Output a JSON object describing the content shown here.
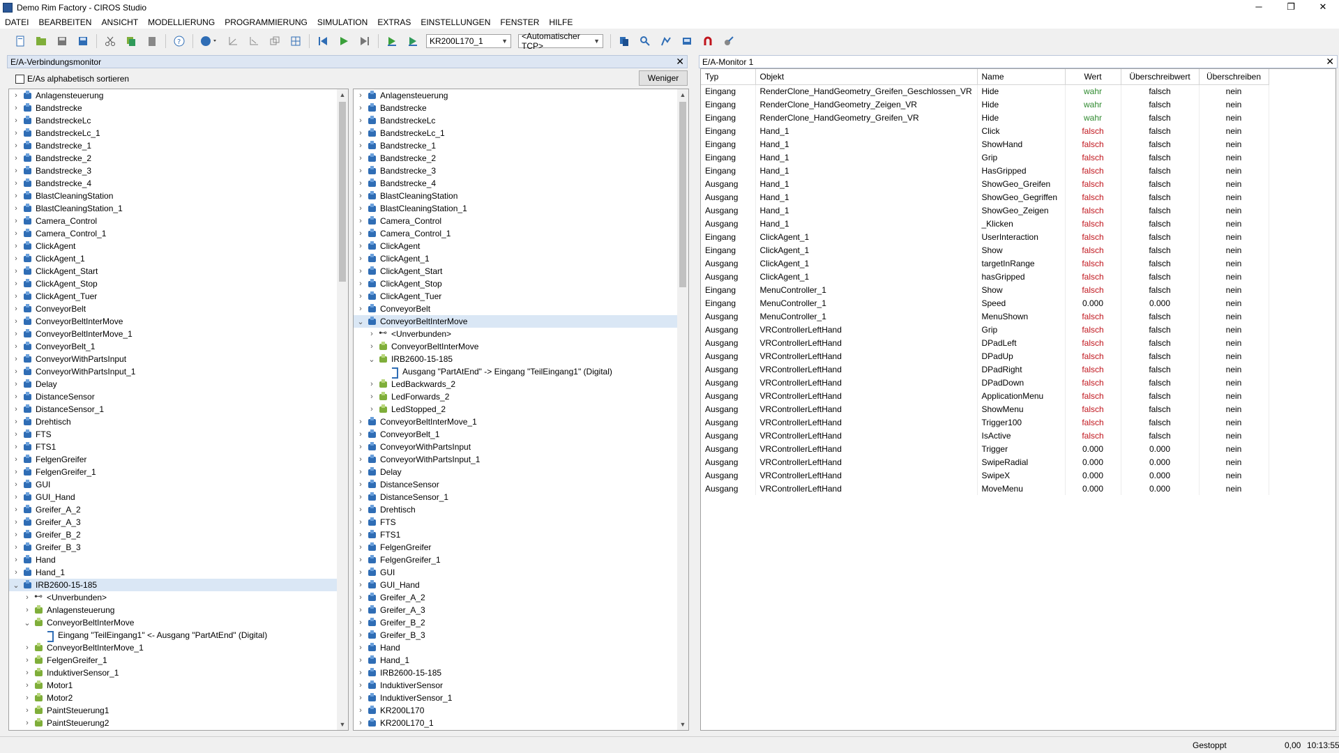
{
  "window": {
    "title": "Demo Rim Factory - CIROS Studio",
    "min": "─",
    "max": "❐",
    "close": "✕"
  },
  "menu": [
    "DATEI",
    "BEARBEITEN",
    "ANSICHT",
    "MODELLIERUNG",
    "PROGRAMMIERUNG",
    "SIMULATION",
    "EXTRAS",
    "EINSTELLUNGEN",
    "FENSTER",
    "HILFE"
  ],
  "toolbar": {
    "robot_select": "KR200L170_1",
    "tcp_select": "<Automatischer TCP>"
  },
  "left_panel": {
    "title": "E/A-Verbindungsmonitor",
    "sort_label": "E/As alphabetisch sortieren",
    "less_button": "Weniger",
    "tree1": [
      {
        "label": "Anlagensteuerung",
        "level": 0,
        "exp": ">",
        "icon": "node"
      },
      {
        "label": "Bandstrecke",
        "level": 0,
        "exp": ">",
        "icon": "node"
      },
      {
        "label": "BandstreckeLc",
        "level": 0,
        "exp": ">",
        "icon": "node"
      },
      {
        "label": "BandstreckeLc_1",
        "level": 0,
        "exp": ">",
        "icon": "node"
      },
      {
        "label": "Bandstrecke_1",
        "level": 0,
        "exp": ">",
        "icon": "node"
      },
      {
        "label": "Bandstrecke_2",
        "level": 0,
        "exp": ">",
        "icon": "node"
      },
      {
        "label": "Bandstrecke_3",
        "level": 0,
        "exp": ">",
        "icon": "node"
      },
      {
        "label": "Bandstrecke_4",
        "level": 0,
        "exp": ">",
        "icon": "node"
      },
      {
        "label": "BlastCleaningStation",
        "level": 0,
        "exp": ">",
        "icon": "node"
      },
      {
        "label": "BlastCleaningStation_1",
        "level": 0,
        "exp": ">",
        "icon": "node"
      },
      {
        "label": "Camera_Control",
        "level": 0,
        "exp": ">",
        "icon": "node"
      },
      {
        "label": "Camera_Control_1",
        "level": 0,
        "exp": ">",
        "icon": "node"
      },
      {
        "label": "ClickAgent",
        "level": 0,
        "exp": ">",
        "icon": "node"
      },
      {
        "label": "ClickAgent_1",
        "level": 0,
        "exp": ">",
        "icon": "node"
      },
      {
        "label": "ClickAgent_Start",
        "level": 0,
        "exp": ">",
        "icon": "node"
      },
      {
        "label": "ClickAgent_Stop",
        "level": 0,
        "exp": ">",
        "icon": "node"
      },
      {
        "label": "ClickAgent_Tuer",
        "level": 0,
        "exp": ">",
        "icon": "node"
      },
      {
        "label": "ConveyorBelt",
        "level": 0,
        "exp": ">",
        "icon": "node"
      },
      {
        "label": "ConveyorBeltInterMove",
        "level": 0,
        "exp": ">",
        "icon": "node"
      },
      {
        "label": "ConveyorBeltInterMove_1",
        "level": 0,
        "exp": ">",
        "icon": "node"
      },
      {
        "label": "ConveyorBelt_1",
        "level": 0,
        "exp": ">",
        "icon": "node"
      },
      {
        "label": "ConveyorWithPartsInput",
        "level": 0,
        "exp": ">",
        "icon": "node"
      },
      {
        "label": "ConveyorWithPartsInput_1",
        "level": 0,
        "exp": ">",
        "icon": "node"
      },
      {
        "label": "Delay",
        "level": 0,
        "exp": ">",
        "icon": "node"
      },
      {
        "label": "DistanceSensor",
        "level": 0,
        "exp": ">",
        "icon": "node"
      },
      {
        "label": "DistanceSensor_1",
        "level": 0,
        "exp": ">",
        "icon": "node"
      },
      {
        "label": "Drehtisch",
        "level": 0,
        "exp": ">",
        "icon": "node"
      },
      {
        "label": "FTS",
        "level": 0,
        "exp": ">",
        "icon": "node"
      },
      {
        "label": "FTS1",
        "level": 0,
        "exp": ">",
        "icon": "node"
      },
      {
        "label": "FelgenGreifer",
        "level": 0,
        "exp": ">",
        "icon": "node"
      },
      {
        "label": "FelgenGreifer_1",
        "level": 0,
        "exp": ">",
        "icon": "node"
      },
      {
        "label": "GUI",
        "level": 0,
        "exp": ">",
        "icon": "node"
      },
      {
        "label": "GUI_Hand",
        "level": 0,
        "exp": ">",
        "icon": "node"
      },
      {
        "label": "Greifer_A_2",
        "level": 0,
        "exp": ">",
        "icon": "node"
      },
      {
        "label": "Greifer_A_3",
        "level": 0,
        "exp": ">",
        "icon": "node"
      },
      {
        "label": "Greifer_B_2",
        "level": 0,
        "exp": ">",
        "icon": "node"
      },
      {
        "label": "Greifer_B_3",
        "level": 0,
        "exp": ">",
        "icon": "node"
      },
      {
        "label": "Hand",
        "level": 0,
        "exp": ">",
        "icon": "node"
      },
      {
        "label": "Hand_1",
        "level": 0,
        "exp": ">",
        "icon": "node"
      },
      {
        "label": "IRB2600-15-185",
        "level": 0,
        "exp": "v",
        "icon": "node",
        "selected": true
      },
      {
        "label": "<Unverbunden>",
        "level": 1,
        "exp": ">",
        "icon": "unb"
      },
      {
        "label": "Anlagensteuerung",
        "level": 1,
        "exp": ">",
        "icon": "conn"
      },
      {
        "label": "ConveyorBeltInterMove",
        "level": 1,
        "exp": "v",
        "icon": "conn"
      },
      {
        "label": "Eingang \"TeilEingang1\" <- Ausgang \"PartAtEnd\" (Digital)",
        "level": 2,
        "exp": "",
        "icon": "sig"
      },
      {
        "label": "ConveyorBeltInterMove_1",
        "level": 1,
        "exp": ">",
        "icon": "conn"
      },
      {
        "label": "FelgenGreifer_1",
        "level": 1,
        "exp": ">",
        "icon": "conn"
      },
      {
        "label": "InduktiverSensor_1",
        "level": 1,
        "exp": ">",
        "icon": "conn"
      },
      {
        "label": "Motor1",
        "level": 1,
        "exp": ">",
        "icon": "conn"
      },
      {
        "label": "Motor2",
        "level": 1,
        "exp": ">",
        "icon": "conn"
      },
      {
        "label": "PaintSteuerung1",
        "level": 1,
        "exp": ">",
        "icon": "conn"
      },
      {
        "label": "PaintSteuerung2",
        "level": 1,
        "exp": ">",
        "icon": "conn"
      }
    ],
    "tree2": [
      {
        "label": "Anlagensteuerung",
        "level": 0,
        "exp": ">",
        "icon": "node"
      },
      {
        "label": "Bandstrecke",
        "level": 0,
        "exp": ">",
        "icon": "node"
      },
      {
        "label": "BandstreckeLc",
        "level": 0,
        "exp": ">",
        "icon": "node"
      },
      {
        "label": "BandstreckeLc_1",
        "level": 0,
        "exp": ">",
        "icon": "node"
      },
      {
        "label": "Bandstrecke_1",
        "level": 0,
        "exp": ">",
        "icon": "node"
      },
      {
        "label": "Bandstrecke_2",
        "level": 0,
        "exp": ">",
        "icon": "node"
      },
      {
        "label": "Bandstrecke_3",
        "level": 0,
        "exp": ">",
        "icon": "node"
      },
      {
        "label": "Bandstrecke_4",
        "level": 0,
        "exp": ">",
        "icon": "node"
      },
      {
        "label": "BlastCleaningStation",
        "level": 0,
        "exp": ">",
        "icon": "node"
      },
      {
        "label": "BlastCleaningStation_1",
        "level": 0,
        "exp": ">",
        "icon": "node"
      },
      {
        "label": "Camera_Control",
        "level": 0,
        "exp": ">",
        "icon": "node"
      },
      {
        "label": "Camera_Control_1",
        "level": 0,
        "exp": ">",
        "icon": "node"
      },
      {
        "label": "ClickAgent",
        "level": 0,
        "exp": ">",
        "icon": "node"
      },
      {
        "label": "ClickAgent_1",
        "level": 0,
        "exp": ">",
        "icon": "node"
      },
      {
        "label": "ClickAgent_Start",
        "level": 0,
        "exp": ">",
        "icon": "node"
      },
      {
        "label": "ClickAgent_Stop",
        "level": 0,
        "exp": ">",
        "icon": "node"
      },
      {
        "label": "ClickAgent_Tuer",
        "level": 0,
        "exp": ">",
        "icon": "node"
      },
      {
        "label": "ConveyorBelt",
        "level": 0,
        "exp": ">",
        "icon": "node"
      },
      {
        "label": "ConveyorBeltInterMove",
        "level": 0,
        "exp": "v",
        "icon": "node",
        "selected": true
      },
      {
        "label": "<Unverbunden>",
        "level": 1,
        "exp": ">",
        "icon": "unb"
      },
      {
        "label": "ConveyorBeltInterMove",
        "level": 1,
        "exp": ">",
        "icon": "conn"
      },
      {
        "label": "IRB2600-15-185",
        "level": 1,
        "exp": "v",
        "icon": "conn"
      },
      {
        "label": "Ausgang \"PartAtEnd\" -> Eingang \"TeilEingang1\" (Digital)",
        "level": 2,
        "exp": "",
        "icon": "sig"
      },
      {
        "label": "LedBackwards_2",
        "level": 1,
        "exp": ">",
        "icon": "conn"
      },
      {
        "label": "LedForwards_2",
        "level": 1,
        "exp": ">",
        "icon": "conn"
      },
      {
        "label": "LedStopped_2",
        "level": 1,
        "exp": ">",
        "icon": "conn"
      },
      {
        "label": "ConveyorBeltInterMove_1",
        "level": 0,
        "exp": ">",
        "icon": "node"
      },
      {
        "label": "ConveyorBelt_1",
        "level": 0,
        "exp": ">",
        "icon": "node"
      },
      {
        "label": "ConveyorWithPartsInput",
        "level": 0,
        "exp": ">",
        "icon": "node"
      },
      {
        "label": "ConveyorWithPartsInput_1",
        "level": 0,
        "exp": ">",
        "icon": "node"
      },
      {
        "label": "Delay",
        "level": 0,
        "exp": ">",
        "icon": "node"
      },
      {
        "label": "DistanceSensor",
        "level": 0,
        "exp": ">",
        "icon": "node"
      },
      {
        "label": "DistanceSensor_1",
        "level": 0,
        "exp": ">",
        "icon": "node"
      },
      {
        "label": "Drehtisch",
        "level": 0,
        "exp": ">",
        "icon": "node"
      },
      {
        "label": "FTS",
        "level": 0,
        "exp": ">",
        "icon": "node"
      },
      {
        "label": "FTS1",
        "level": 0,
        "exp": ">",
        "icon": "node"
      },
      {
        "label": "FelgenGreifer",
        "level": 0,
        "exp": ">",
        "icon": "node"
      },
      {
        "label": "FelgenGreifer_1",
        "level": 0,
        "exp": ">",
        "icon": "node"
      },
      {
        "label": "GUI",
        "level": 0,
        "exp": ">",
        "icon": "node"
      },
      {
        "label": "GUI_Hand",
        "level": 0,
        "exp": ">",
        "icon": "node"
      },
      {
        "label": "Greifer_A_2",
        "level": 0,
        "exp": ">",
        "icon": "node"
      },
      {
        "label": "Greifer_A_3",
        "level": 0,
        "exp": ">",
        "icon": "node"
      },
      {
        "label": "Greifer_B_2",
        "level": 0,
        "exp": ">",
        "icon": "node"
      },
      {
        "label": "Greifer_B_3",
        "level": 0,
        "exp": ">",
        "icon": "node"
      },
      {
        "label": "Hand",
        "level": 0,
        "exp": ">",
        "icon": "node"
      },
      {
        "label": "Hand_1",
        "level": 0,
        "exp": ">",
        "icon": "node"
      },
      {
        "label": "IRB2600-15-185",
        "level": 0,
        "exp": ">",
        "icon": "node"
      },
      {
        "label": "InduktiverSensor",
        "level": 0,
        "exp": ">",
        "icon": "node"
      },
      {
        "label": "InduktiverSensor_1",
        "level": 0,
        "exp": ">",
        "icon": "node"
      },
      {
        "label": "KR200L170",
        "level": 0,
        "exp": ">",
        "icon": "node"
      },
      {
        "label": "KR200L170_1",
        "level": 0,
        "exp": ">",
        "icon": "node"
      }
    ]
  },
  "io_monitor": {
    "title": "E/A-Monitor 1",
    "columns": [
      "Typ",
      "Objekt",
      "Name",
      "Wert",
      "Überschreibwert",
      "Überschreiben"
    ],
    "rows": [
      [
        "Eingang",
        "RenderClone_HandGeometry_Greifen_Geschlossen_VR",
        "Hide",
        "wahr",
        "falsch",
        "nein"
      ],
      [
        "Eingang",
        "RenderClone_HandGeometry_Zeigen_VR",
        "Hide",
        "wahr",
        "falsch",
        "nein"
      ],
      [
        "Eingang",
        "RenderClone_HandGeometry_Greifen_VR",
        "Hide",
        "wahr",
        "falsch",
        "nein"
      ],
      [
        "Eingang",
        "Hand_1",
        "Click",
        "falsch",
        "falsch",
        "nein"
      ],
      [
        "Eingang",
        "Hand_1",
        "ShowHand",
        "falsch",
        "falsch",
        "nein"
      ],
      [
        "Eingang",
        "Hand_1",
        "Grip",
        "falsch",
        "falsch",
        "nein"
      ],
      [
        "Eingang",
        "Hand_1",
        "HasGripped",
        "falsch",
        "falsch",
        "nein"
      ],
      [
        "Ausgang",
        "Hand_1",
        "ShowGeo_Greifen",
        "falsch",
        "falsch",
        "nein"
      ],
      [
        "Ausgang",
        "Hand_1",
        "ShowGeo_Gegriffen",
        "falsch",
        "falsch",
        "nein"
      ],
      [
        "Ausgang",
        "Hand_1",
        "ShowGeo_Zeigen",
        "falsch",
        "falsch",
        "nein"
      ],
      [
        "Ausgang",
        "Hand_1",
        "_Klicken",
        "falsch",
        "falsch",
        "nein"
      ],
      [
        "Eingang",
        "ClickAgent_1",
        "UserInteraction",
        "falsch",
        "falsch",
        "nein"
      ],
      [
        "Eingang",
        "ClickAgent_1",
        "Show",
        "falsch",
        "falsch",
        "nein"
      ],
      [
        "Ausgang",
        "ClickAgent_1",
        "targetInRange",
        "falsch",
        "falsch",
        "nein"
      ],
      [
        "Ausgang",
        "ClickAgent_1",
        "hasGripped",
        "falsch",
        "falsch",
        "nein"
      ],
      [
        "Eingang",
        "MenuController_1",
        "Show",
        "falsch",
        "falsch",
        "nein"
      ],
      [
        "Eingang",
        "MenuController_1",
        "Speed",
        "0.000",
        "0.000",
        "nein"
      ],
      [
        "Ausgang",
        "MenuController_1",
        "MenuShown",
        "falsch",
        "falsch",
        "nein"
      ],
      [
        "Ausgang",
        "VRControllerLeftHand",
        "Grip",
        "falsch",
        "falsch",
        "nein"
      ],
      [
        "Ausgang",
        "VRControllerLeftHand",
        "DPadLeft",
        "falsch",
        "falsch",
        "nein"
      ],
      [
        "Ausgang",
        "VRControllerLeftHand",
        "DPadUp",
        "falsch",
        "falsch",
        "nein"
      ],
      [
        "Ausgang",
        "VRControllerLeftHand",
        "DPadRight",
        "falsch",
        "falsch",
        "nein"
      ],
      [
        "Ausgang",
        "VRControllerLeftHand",
        "DPadDown",
        "falsch",
        "falsch",
        "nein"
      ],
      [
        "Ausgang",
        "VRControllerLeftHand",
        "ApplicationMenu",
        "falsch",
        "falsch",
        "nein"
      ],
      [
        "Ausgang",
        "VRControllerLeftHand",
        "ShowMenu",
        "falsch",
        "falsch",
        "nein"
      ],
      [
        "Ausgang",
        "VRControllerLeftHand",
        "Trigger100",
        "falsch",
        "falsch",
        "nein"
      ],
      [
        "Ausgang",
        "VRControllerLeftHand",
        "IsActive",
        "falsch",
        "falsch",
        "nein"
      ],
      [
        "Ausgang",
        "VRControllerLeftHand",
        "Trigger",
        "0.000",
        "0.000",
        "nein"
      ],
      [
        "Ausgang",
        "VRControllerLeftHand",
        "SwipeRadial",
        "0.000",
        "0.000",
        "nein"
      ],
      [
        "Ausgang",
        "VRControllerLeftHand",
        "SwipeX",
        "0.000",
        "0.000",
        "nein"
      ],
      [
        "Ausgang",
        "VRControllerLeftHand",
        "MoveMenu",
        "0.000",
        "0.000",
        "nein"
      ]
    ]
  },
  "status": {
    "state": "Gestoppt",
    "value": "0,00",
    "time": "10:13:55"
  },
  "colors": {
    "true_value": "#2f8a2f",
    "false_value": "#c0141c",
    "panel_header": "#dde6f3",
    "selection": "#dae7f5"
  }
}
